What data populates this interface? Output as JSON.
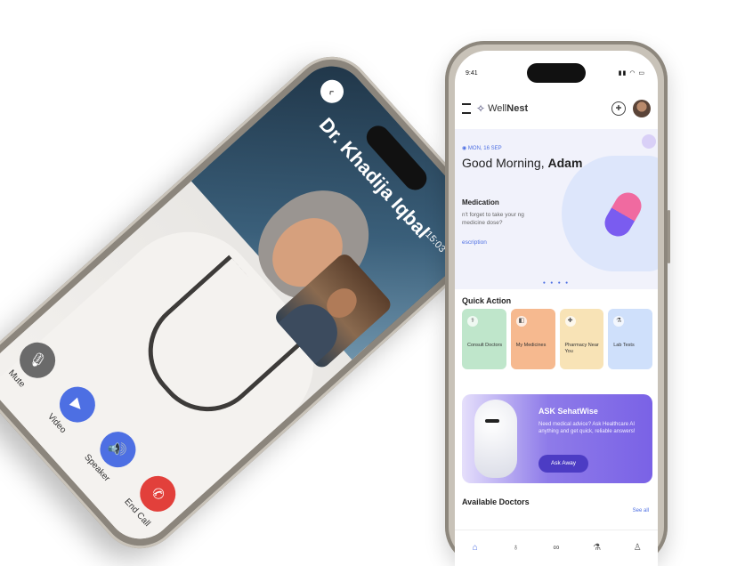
{
  "video_call": {
    "doctor_name": "Dr. Khadija Iqbal",
    "call_time": "15:03",
    "controls": [
      {
        "label": "Mute",
        "icon": "microphone-icon",
        "color": "#6a6a6a"
      },
      {
        "label": "Video",
        "icon": "video-icon",
        "color": "#4d6fe3"
      },
      {
        "label": "Speaker",
        "icon": "speaker-icon",
        "color": "#4d6fe3"
      },
      {
        "label": "End Call",
        "icon": "phone-end-icon",
        "color": "#e2403b"
      }
    ]
  },
  "app": {
    "status_time": "9:41",
    "brand": {
      "prefix": "Well",
      "suffix": "Nest"
    },
    "hero": {
      "date": "MON, 16 SEP",
      "greeting_prefix": "Good Morning,",
      "user_name": "Adam",
      "medication_title": "Medication",
      "medication_text": "n't forget to take your ng medicine dose?",
      "medication_link": "escription"
    },
    "quick_action": {
      "title": "Quick Action",
      "items": [
        {
          "label": "Consult Doctors",
          "color": "#bfe6cb",
          "icon": "doctor-icon"
        },
        {
          "label": "My Medicines",
          "color": "#f6b98f",
          "icon": "medicine-icon"
        },
        {
          "label": "Pharmacy Near You",
          "color": "#f8e3b6",
          "icon": "pharmacy-icon"
        },
        {
          "label": "Lab Tests",
          "color": "#cfe0fb",
          "icon": "lab-icon"
        }
      ]
    },
    "ask": {
      "title": "ASK SehatWise",
      "text": "Need medical advice? Ask Healthcare AI anything and get quick, reliable answers!",
      "button": "Ask Away"
    },
    "doctors": {
      "title": "Available Doctors",
      "see_all": "See all"
    },
    "nav": [
      "home-icon",
      "stethoscope-icon",
      "pill-icon",
      "flask-icon",
      "profile-icon"
    ],
    "accent": "#4d6fe3"
  }
}
